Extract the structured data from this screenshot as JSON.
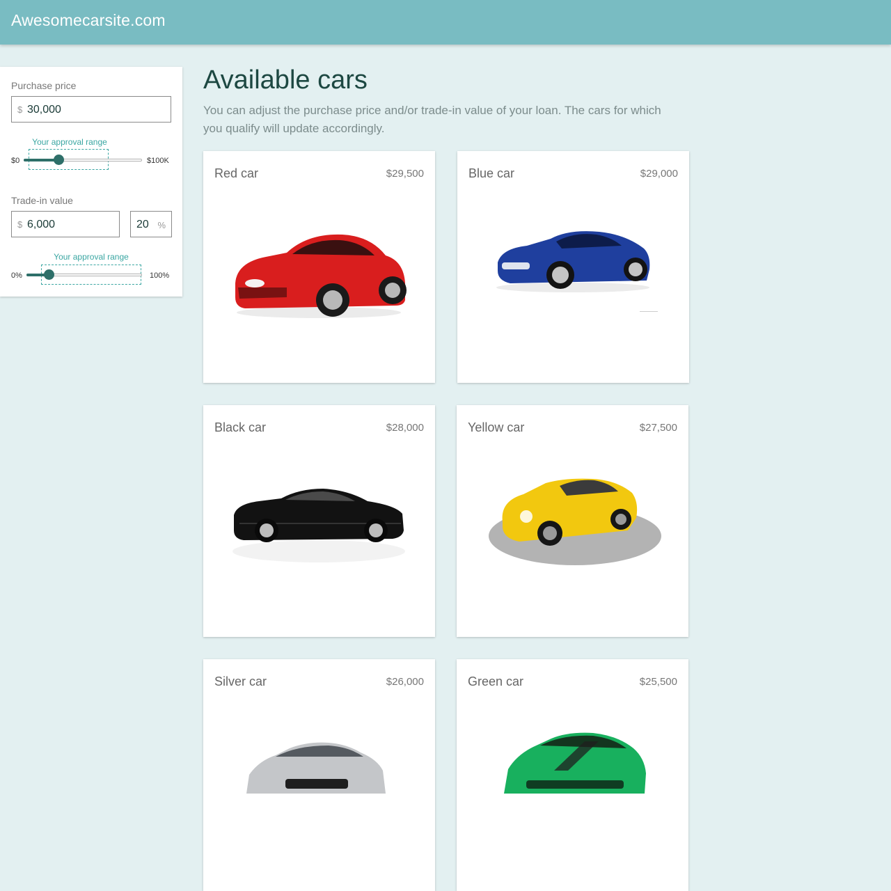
{
  "header": {
    "brand": "Awesomecarsite.com",
    "color": "#79bcc2"
  },
  "filters": {
    "purchase": {
      "label": "Purchase price",
      "currency": "$",
      "value": "30,000",
      "approval_label": "Your approval range",
      "min_label": "$0",
      "max_label": "$100K",
      "slider_fraction": 0.3
    },
    "tradein": {
      "label": "Trade-in value",
      "currency": "$",
      "value": "6,000",
      "percent_value": "20",
      "percent_symbol": "%",
      "approval_label": "Your approval range",
      "min_label": "0%",
      "max_label": "100%",
      "slider_fraction": 0.2
    }
  },
  "main": {
    "title": "Available cars",
    "description": "You can adjust the purchase price and/or trade-in value of your loan. The cars for which you qualify will update accordingly."
  },
  "cars": [
    {
      "name": "Red car",
      "price": "$29,500",
      "color": "#d91e1e",
      "icon": "red-car-image"
    },
    {
      "name": "Blue car",
      "price": "$29,000",
      "color": "#1f3f9e",
      "icon": "blue-car-image"
    },
    {
      "name": "Black car",
      "price": "$28,000",
      "color": "#121212",
      "icon": "black-car-image"
    },
    {
      "name": "Yellow car",
      "price": "$27,500",
      "color": "#f2c80f",
      "icon": "yellow-car-image"
    },
    {
      "name": "Silver car",
      "price": "$26,000",
      "color": "#c4c6c9",
      "icon": "silver-car-image"
    },
    {
      "name": "Green car",
      "price": "$25,500",
      "color": "#18b05e",
      "icon": "green-car-image"
    }
  ]
}
